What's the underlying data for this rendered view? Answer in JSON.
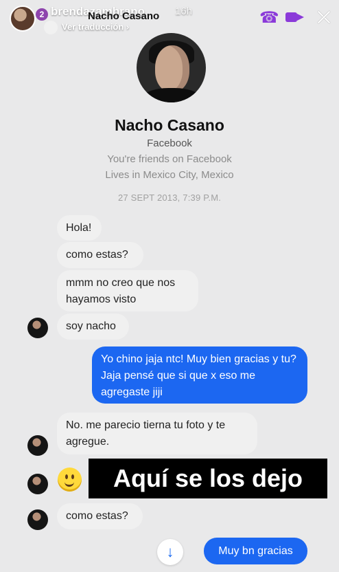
{
  "story": {
    "count": "2",
    "username": "brendazambrano",
    "time": "16h",
    "translation": "Ver traducción"
  },
  "header": {
    "name": "Nacho Casano"
  },
  "profile": {
    "name": "Nacho Casano",
    "network": "Facebook",
    "friends": "You're friends on Facebook",
    "location": "Lives in Mexico City, Mexico",
    "timestamp": "27 SEPT 2013, 7:39 P.M."
  },
  "messages": [
    {
      "text": "Hola!"
    },
    {
      "text": "como estas?"
    },
    {
      "text": "mmm no creo que nos hayamos visto"
    },
    {
      "text": "soy nacho"
    },
    {
      "text": "Yo chino jaja ntc! Muy bien gracias y tu? Jaja pensé que si que x eso me agregaste jiji"
    },
    {
      "text": "No. me parecio tierna tu foto y te agregue."
    },
    {
      "text": "como estas?"
    }
  ],
  "caption": "Aquí se los dejo",
  "quick_reply": "Muy bn gracias",
  "icons": [
    "phone-icon",
    "video-icon",
    "close-icon",
    "down-arrow-icon",
    "smile-emoji-icon"
  ],
  "colors": {
    "messenger_blue": "#1c67f1",
    "accent_purple": "#8b3ad9",
    "bubble_gray": "#f0f0f0"
  }
}
